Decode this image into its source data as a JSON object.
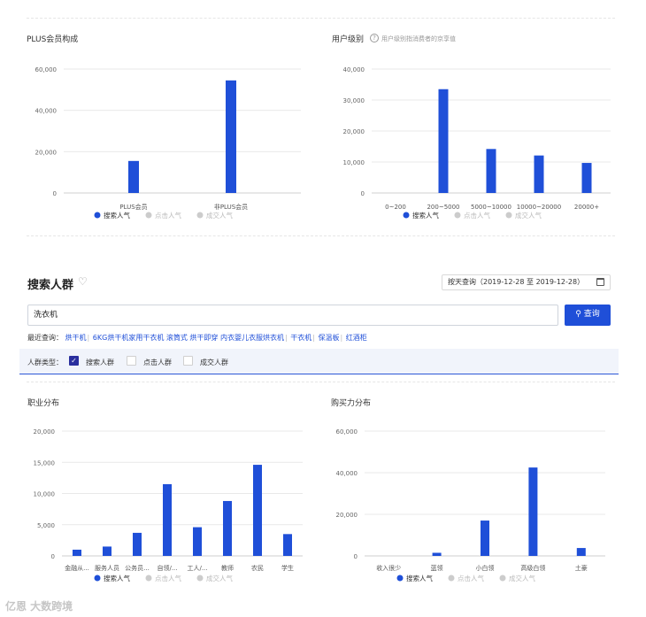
{
  "plus_panel": {
    "title": "PLUS会员构成"
  },
  "level_panel": {
    "title": "用户级别",
    "help_icon": "?",
    "subtitle": "用户级别指消费者的京享值"
  },
  "crowd_section": {
    "title": "搜索人群",
    "date_range": "按天查询（2019-12-28 至 2019-12-28）",
    "search_value": "洗衣机",
    "search_button": "查询",
    "recent_label": "最近查询：",
    "recent_items": [
      "烘干机",
      "6KG烘干机家用干衣机 滚筒式 烘干即穿 内衣婴儿衣服烘衣机",
      "干衣机",
      "保温板",
      "红酒柜"
    ],
    "crowd_type_label": "人群类型：",
    "crowd_types": [
      {
        "label": "搜索人群",
        "checked": true
      },
      {
        "label": "点击人群",
        "checked": false
      },
      {
        "label": "成交人群",
        "checked": false
      }
    ]
  },
  "job_panel": {
    "title": "职业分布"
  },
  "power_panel": {
    "title": "购买力分布"
  },
  "watermark": "亿恩 大数跨境",
  "colors": {
    "accent": "#1f4fd8",
    "inactive": "#cccccc",
    "grid": "#e9e9e9"
  },
  "chart_data": [
    {
      "id": "plus",
      "type": "bar",
      "categories": [
        "PLUS会员",
        "非PLUS会员"
      ],
      "yticks": [
        "0",
        "20,000",
        "40,000",
        "60,000"
      ],
      "ylim": [
        0,
        60000
      ],
      "series": [
        {
          "name": "搜索人气",
          "values": [
            15500,
            54500
          ]
        }
      ],
      "legend": [
        "搜索人气",
        "点击人气",
        "成交人气"
      ],
      "legend_placement": "bottom"
    },
    {
      "id": "level",
      "type": "bar",
      "categories": [
        "0~200",
        "200~5000",
        "5000~10000",
        "10000~20000",
        "20000+"
      ],
      "yticks": [
        "0",
        "10,000",
        "20,000",
        "30,000",
        "40,000"
      ],
      "ylim": [
        0,
        40000
      ],
      "series": [
        {
          "name": "搜索人气",
          "values": [
            0,
            33500,
            14200,
            12100,
            9700
          ]
        }
      ],
      "legend": [
        "搜索人气",
        "点击人气",
        "成交人气"
      ],
      "legend_placement": "bottom"
    },
    {
      "id": "job",
      "type": "bar",
      "categories": [
        "金融从...",
        "服务人员",
        "公务员...",
        "自领/...",
        "工人/...",
        "教师",
        "农民",
        "学生"
      ],
      "yticks": [
        "0",
        "5,000",
        "10,000",
        "15,000",
        "20,000"
      ],
      "ylim": [
        0,
        20000
      ],
      "series": [
        {
          "name": "搜索人气",
          "values": [
            1000,
            1500,
            3700,
            11500,
            4600,
            8800,
            14600,
            3500
          ]
        }
      ],
      "legend": [
        "搜索人气",
        "点击人气",
        "成交人气"
      ],
      "legend_placement": "bottom"
    },
    {
      "id": "power",
      "type": "bar",
      "categories": [
        "收入很少",
        "蓝领",
        "小白领",
        "高级白领",
        "土豪"
      ],
      "yticks": [
        "0",
        "20,000",
        "40,000",
        "60,000"
      ],
      "ylim": [
        0,
        60000
      ],
      "series": [
        {
          "name": "搜索人气",
          "values": [
            0,
            1500,
            17000,
            42500,
            3800
          ]
        }
      ],
      "legend": [
        "搜索人气",
        "点击人气",
        "成交人气"
      ],
      "legend_placement": "bottom"
    }
  ]
}
